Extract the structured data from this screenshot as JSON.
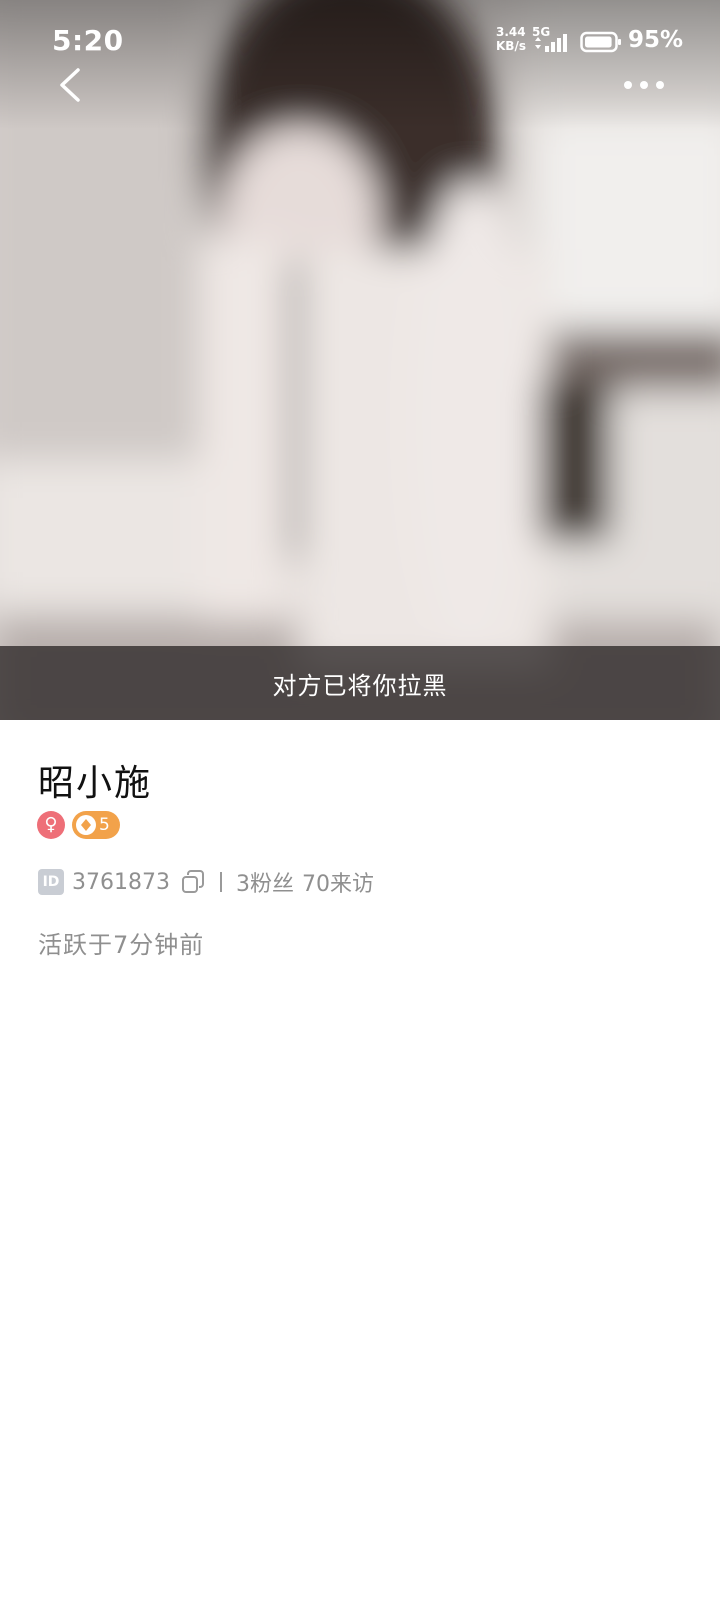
{
  "status_bar": {
    "time": "5:20",
    "net_speed_value": "3.44",
    "net_speed_unit": "KB/s",
    "net_type": "5G",
    "battery_percent": "95%",
    "battery_level": 0.95
  },
  "nav": {
    "back_icon": "chevron-left-icon",
    "more_icon": "more-dots-icon"
  },
  "hero": {
    "blocked_notice": "对方已将你拉黑"
  },
  "profile": {
    "nickname": "昭小施",
    "gender_symbol": "♀",
    "gender_color": "#ee6f78",
    "level": "5",
    "level_color": "#f2a24a",
    "id_tag": "ID",
    "user_id": "3761873",
    "followers": "3粉丝",
    "visitors": "70来访",
    "active_status": "活跃于7分钟前"
  }
}
